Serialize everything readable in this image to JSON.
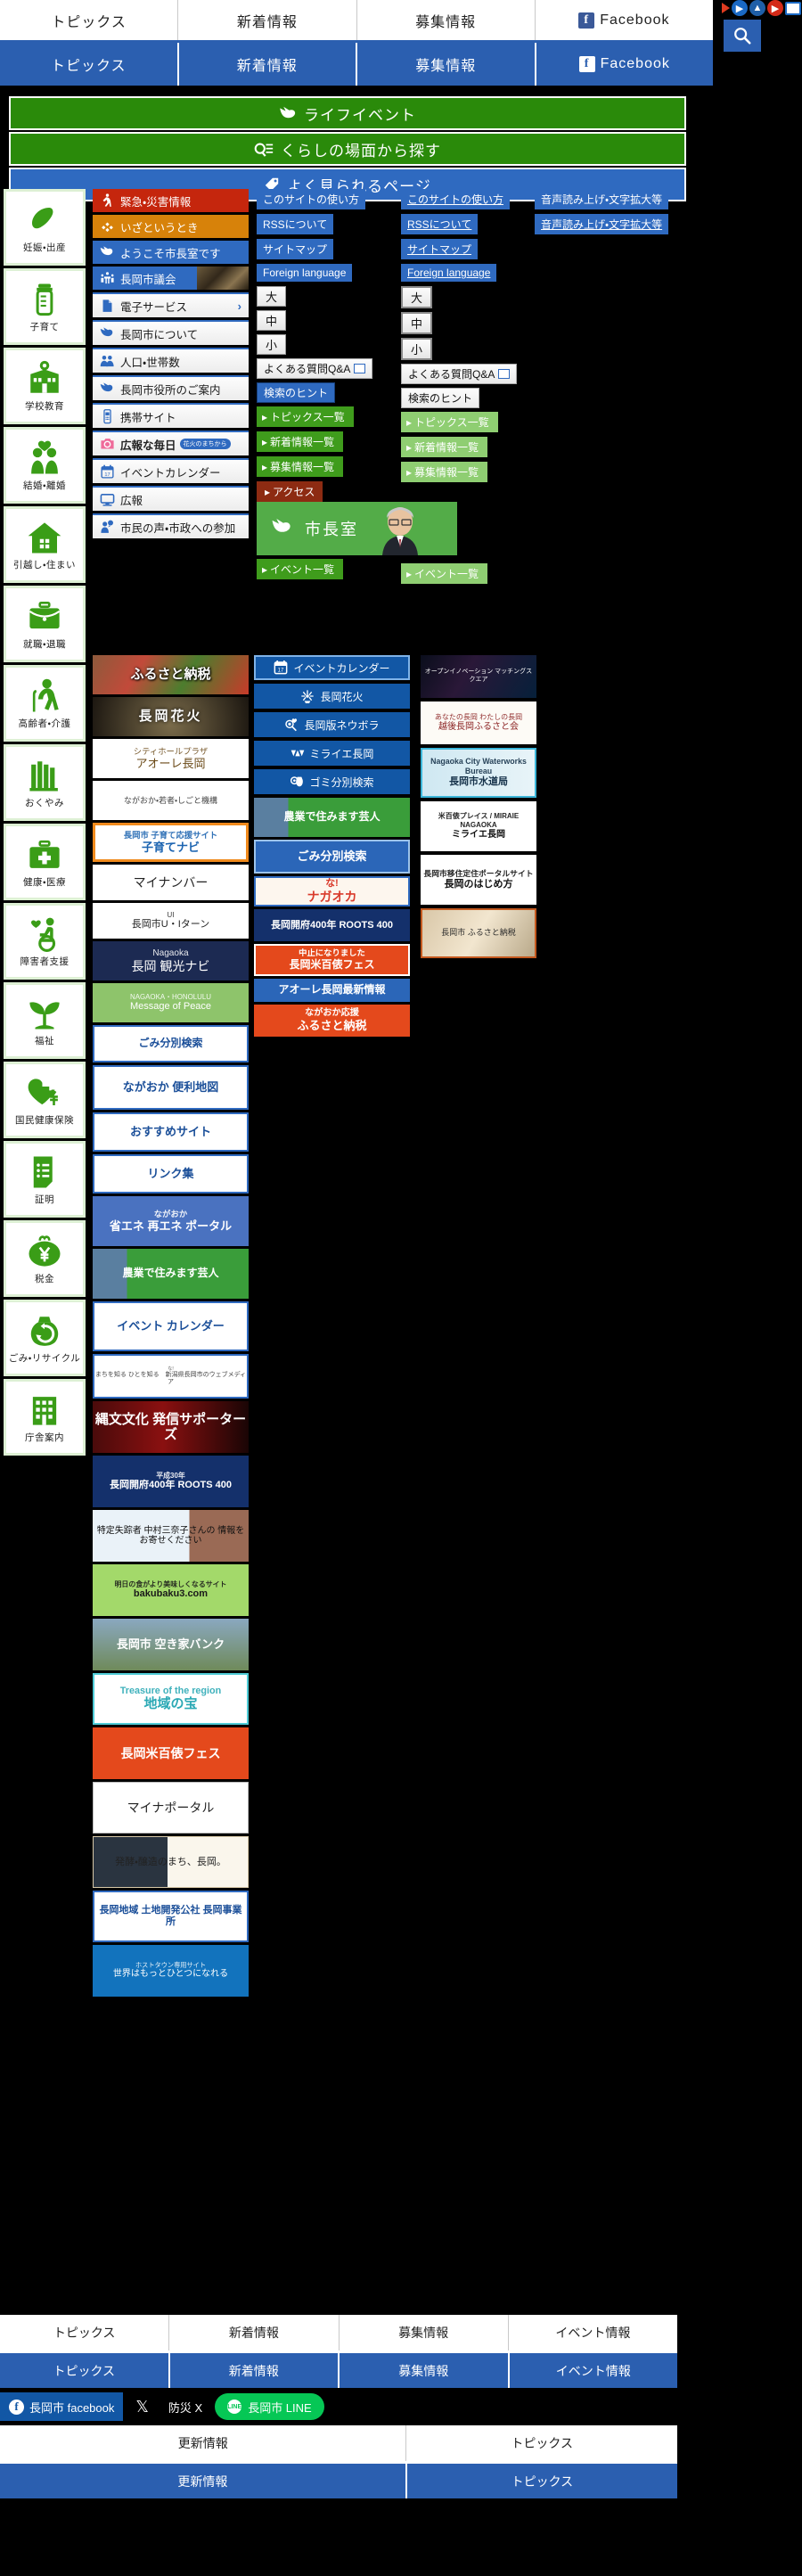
{
  "top_nav": {
    "items": [
      "トピックス",
      "新着情報",
      "募集情報",
      "Facebook"
    ],
    "fb_glyph": "f"
  },
  "toolbar": {
    "search_icon": "search-icon",
    "icons": [
      "play-icon",
      "next-icon",
      "up-icon",
      "forward-icon",
      "window-icon"
    ]
  },
  "bars": [
    {
      "label": "ライフイベント",
      "icon": "bird-icon",
      "color": "#2a8a0a"
    },
    {
      "label": "くらしの場面から探す",
      "icon": "search-list-icon",
      "color": "#2a8a0a"
    },
    {
      "label": "よく見られるページ",
      "icon": "tag-icon",
      "color": "#2f6ac0"
    }
  ],
  "sidebar": {
    "items": [
      {
        "label": "妊娠・出産",
        "icon": "baby-icon"
      },
      {
        "label": "子育て",
        "icon": "baby-bottle-icon"
      },
      {
        "label": "学校教育",
        "icon": "school-icon"
      },
      {
        "label": "結婚・離婚",
        "icon": "couple-heart-icon"
      },
      {
        "label": "引越し・住まい",
        "icon": "house-icon"
      },
      {
        "label": "就職・退職",
        "icon": "briefcase-icon"
      },
      {
        "label": "高齢者・介護",
        "icon": "elderly-cane-icon"
      },
      {
        "label": "おくやみ",
        "icon": "grave-icon"
      },
      {
        "label": "健康・医療",
        "icon": "first-aid-icon"
      },
      {
        "label": "障害者支援",
        "icon": "wheelchair-heart-icon"
      },
      {
        "label": "福祉",
        "icon": "sprout-icon"
      },
      {
        "label": "国民健康保険",
        "icon": "heart-yen-icon"
      },
      {
        "label": "証明",
        "icon": "document-list-icon"
      },
      {
        "label": "税金",
        "icon": "coin-purse-yen-icon"
      },
      {
        "label": "ごみ・リサイクル",
        "icon": "recycle-bag-icon"
      },
      {
        "label": "庁舎案内",
        "icon": "building-icon"
      }
    ]
  },
  "menu": {
    "items": [
      {
        "label": "緊急・災害情報",
        "icon": "running-person-icon",
        "style": "m-red"
      },
      {
        "label": "いざというとき",
        "icon": "diamonds-icon",
        "style": "m-orange"
      },
      {
        "label": "ようこそ市長室です",
        "icon": "bird-icon",
        "style": "m-blue"
      },
      {
        "label": "長岡市議会",
        "icon": "assembly-icon",
        "style": "m-blue",
        "photo": true
      },
      {
        "label": "電子サービス",
        "icon": "document-icon",
        "style": "m-light",
        "chevron": "›"
      },
      {
        "label": "長岡市について",
        "icon": "bird-icon",
        "style": "m-light"
      },
      {
        "label": "人口・世帯数",
        "icon": "people-icon",
        "style": "m-light"
      },
      {
        "label": "長岡市役所のご案内",
        "icon": "bird-icon",
        "style": "m-light"
      },
      {
        "label": "携帯サイト",
        "icon": "mobile-phone-icon",
        "style": "m-light"
      },
      {
        "label": "広報な毎日",
        "icon": "camera-icon",
        "style": "m-light",
        "pill": "花火のまちから",
        "bold": true
      },
      {
        "label": "イベントカレンダー",
        "icon": "calendar-icon",
        "style": "m-light"
      },
      {
        "label": "広報",
        "icon": "monitor-icon",
        "style": "m-light"
      },
      {
        "label": "市民の声・市政への参加",
        "icon": "speech-person-icon",
        "style": "m-light"
      }
    ]
  },
  "banners_col2": [
    {
      "name": "furusato-nozei",
      "text": "ふるさと納税",
      "kind": "photo-food",
      "h": 44
    },
    {
      "name": "nagaoka-hanabi",
      "text": "長岡花火",
      "kind": "photo-fireworks",
      "h": 44
    },
    {
      "name": "aore-nagaoka",
      "text": "アオーレ長岡",
      "sub": "シティホールプラザ",
      "kind": "white-diamond",
      "h": 44
    },
    {
      "name": "nagaoka-wakamono-shigoto",
      "text": "ながおか・若者・しごと機構",
      "kind": "white-plain",
      "h": 44
    },
    {
      "name": "kosodate-navi",
      "text": "子育てナビ",
      "sub": "長岡市 子育て応援サイト",
      "kind": "orange-frame",
      "h": 44
    },
    {
      "name": "my-number",
      "text": "マイナンバー",
      "kind": "white-rabbit",
      "h": 40
    },
    {
      "name": "ui-turn",
      "text": "長岡市U・Iターン",
      "sub": "UI",
      "kind": "white-ui",
      "h": 40
    },
    {
      "name": "kankou-navi",
      "text": "長岡 観光ナビ",
      "sub": "Nagaoka",
      "kind": "navy-burst",
      "h": 44
    },
    {
      "name": "message-of-peace",
      "text": "Message of Peace",
      "sub": "NAGAOKA・HONOLULU",
      "kind": "green-peace",
      "h": 44
    },
    {
      "name": "gomi-bunbetsu-1",
      "text": "ごみ分別検索",
      "kind": "white-blue-bird",
      "h": 42
    },
    {
      "name": "nagaoka-benri-chizu",
      "text": "ながおか 便利地図",
      "kind": "white-map",
      "h": 50
    },
    {
      "name": "osusume-site",
      "text": "おすすめサイト",
      "kind": "white-link",
      "h": 44
    },
    {
      "name": "link-shu",
      "text": "リンク集",
      "kind": "white-link",
      "h": 44
    },
    {
      "name": "shoene-saiene-portal",
      "text": "省エネ 再エネ ポータル",
      "sub": "ながおか",
      "kind": "blue-energy",
      "h": 56
    },
    {
      "name": "nougyou-sumimasu-geinin",
      "text": "農業で住みます芸人",
      "kind": "green-farmer",
      "h": 56
    },
    {
      "name": "event-calendar-banner",
      "text": "イベント カレンダー",
      "kind": "white-calendar",
      "h": 56
    },
    {
      "name": "na-nagaoka-web",
      "text": "まちを知る ひとを知る　新潟県長岡市のウェブメディア",
      "sub": "な!",
      "kind": "white-na",
      "h": 50
    },
    {
      "name": "jomon-bunka-supporters",
      "text": "縄文文化 発信サポーターズ",
      "kind": "dark-red-flame",
      "h": 58
    },
    {
      "name": "roots400",
      "text": "長岡開府400年 ROOTS 400",
      "sub": "平成30年",
      "kind": "navy-roots",
      "h": 58
    },
    {
      "name": "nakamura-minako",
      "text": "特定失踪者 中村三奈子さんの 情報をお寄せください",
      "kind": "white-portrait",
      "h": 58
    },
    {
      "name": "bakubaku3",
      "text": "bakubaku3.com",
      "sub": "明日の食がより美味しくなるサイト",
      "kind": "green-bakubaku",
      "h": 58
    },
    {
      "name": "akiya-bank",
      "text": "長岡市 空き家バンク",
      "kind": "photo-akiya",
      "h": 58
    },
    {
      "name": "chiiki-no-takara",
      "text": "地域の宝",
      "sub": "Treasure of the region",
      "kind": "white-takara",
      "h": 58
    },
    {
      "name": "nagaoka-komehyou-fes",
      "text": "長岡米百俵フェス",
      "kind": "orange-fes",
      "h": 58
    },
    {
      "name": "myna-portal",
      "text": "マイナポータル",
      "kind": "white-myna",
      "h": 58
    },
    {
      "name": "hakkou-jouzou",
      "text": "発酵・醸造のまち、長岡。",
      "kind": "photo-hakkou",
      "h": 58
    },
    {
      "name": "tochikaihatsu-kousha",
      "text": "長岡地域 土地開発公社 長岡事業所",
      "kind": "white-flag",
      "h": 58
    },
    {
      "name": "host-town",
      "text": "世界はもっとひとつになれる",
      "sub": "ホストタウン専用サイト",
      "kind": "blue-hosttown",
      "h": 58
    }
  ],
  "col3_buttons": [
    {
      "label": "イベントカレンダー",
      "icon": "calendar-icon",
      "outlined": true
    },
    {
      "label": "長岡花火",
      "icon": "fireworks-icon",
      "outlined": false
    },
    {
      "label": "長岡版ネウボラ",
      "icon": "neuvola-icon",
      "outlined": false
    },
    {
      "label": "ミライエ長岡",
      "icon": "miraie-icon",
      "outlined": false
    },
    {
      "label": "ゴミ分別検索",
      "icon": "trash-search-icon",
      "outlined": false
    }
  ],
  "col3_banners": [
    {
      "name": "nougyou-sumimasu-geinin-2",
      "text": "農業で住みます芸人",
      "kind": "green-farmer",
      "h": 44
    },
    {
      "name": "gomi-bunbetsu-2",
      "text": "ごみ分別検索",
      "kind": "blue-gomi",
      "h": 38
    },
    {
      "name": "na-nagaoka-2",
      "text": "ナガオカ",
      "sub": "な!",
      "kind": "white-na-big",
      "h": 34
    },
    {
      "name": "roots400-2",
      "text": "長岡開府400年 ROOTS 400",
      "kind": "navy-roots",
      "h": 36
    },
    {
      "name": "komehyou-chuushi",
      "text": "長岡米百俵フェス",
      "sub": "中止になりました",
      "kind": "orange-fes-cancel",
      "h": 36
    },
    {
      "name": "aore-saishin",
      "text": "アオーレ長岡最新情報",
      "kind": "blue-aore",
      "h": 26
    },
    {
      "name": "nagaoka-ouen-furusato",
      "text": "ふるさと納税",
      "sub": "ながおか応援",
      "kind": "orange-furusato",
      "h": 36
    }
  ],
  "col4_images": [
    {
      "name": "open-innovation-matching-square",
      "text": "オープンイノベーション マッチングスクエア",
      "kind": "dark-oi",
      "h": 48
    },
    {
      "name": "echigo-nagaoka-furusato-kai",
      "text": "越後長岡ふるさと会",
      "sub": "あなたの長岡 わたしの長岡",
      "kind": "white-echigo",
      "h": 48
    },
    {
      "name": "nagaoka-suidoukyoku",
      "text": "長岡市水道局",
      "sub": "Nagaoka City Waterworks Bureau",
      "kind": "cyan-water",
      "h": 56
    },
    {
      "name": "miraie-nagaoka",
      "text": "ミライエ長岡",
      "sub": "米百俵プレイス / MIRAIE NAGAOKA",
      "kind": "white-miraie",
      "h": 56
    },
    {
      "name": "nagaoka-no-hajimekata",
      "text": "長岡のはじめ方",
      "sub": "長岡市移住定住ポータルサイト",
      "kind": "white-hajime",
      "h": 56
    },
    {
      "name": "nagaoka-furusato-nozei",
      "text": "長岡市 ふるさと納税",
      "kind": "orange-frame-photo",
      "h": 56
    }
  ],
  "help_col_a": {
    "links": [
      "このサイトの使い方",
      "RSSについて",
      "サイトマップ",
      "Foreign language"
    ],
    "sizes": [
      "大",
      "中",
      "小"
    ],
    "qa": "よくある質問Q&A",
    "hint": "検索のヒント",
    "green": [
      "トピックス一覧",
      "新着情報一覧",
      "募集情報一覧"
    ],
    "access": "アクセス",
    "mayor": "市長室",
    "event_list": "イベント一覧"
  },
  "help_col_b": {
    "links": [
      "このサイトの使い方",
      "RSSについて",
      "サイトマップ",
      "Foreign language"
    ],
    "sizes": [
      "大",
      "中",
      "小"
    ],
    "qa": "よくある質問Q&A",
    "hint": "検索のヒント",
    "green": [
      "トピックス一覧",
      "新着情報一覧",
      "募集情報一覧"
    ],
    "event_list": "イベント一覧"
  },
  "help_col_c": {
    "links": [
      "音声読み上げ・文字拡大等",
      "音声読み上げ・文字拡大等"
    ]
  },
  "footer": {
    "nav_top": [
      "トピックス",
      "新着情報",
      "募集情報",
      "イベント情報"
    ],
    "nav_top2": [
      "トピックス",
      "新着情報",
      "募集情報",
      "イベント情報"
    ],
    "social": {
      "facebook": "長岡市 facebook",
      "x_label": "防災 X",
      "x_glyph": "𝕏",
      "line": "長岡市 LINE",
      "line_glyph": "LINE"
    },
    "nav_bottom": [
      "更新情報",
      "トピックス"
    ],
    "nav_bottom2": [
      "更新情報",
      "トピックス"
    ]
  }
}
